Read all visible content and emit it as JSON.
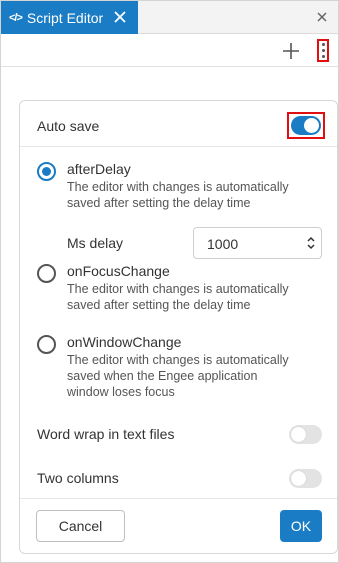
{
  "tab": {
    "title": "Script Editor",
    "icon": "code-icon",
    "active_color": "#1a7cc4"
  },
  "toolbar": {
    "add_icon": "plus-icon",
    "more_icon": "vertical-dots-icon"
  },
  "settings": {
    "auto_save": {
      "label": "Auto save",
      "enabled": true
    },
    "options": [
      {
        "title": "afterDelay",
        "description": "The editor with changes is automatically saved after setting the delay time",
        "selected": true
      },
      {
        "title": "onFocusChange",
        "description": "The editor with changes is automatically saved after setting the delay time",
        "selected": false
      },
      {
        "title": "onWindowChange",
        "description": "The editor with changes is automatically saved when the Engee application window loses focus",
        "selected": false
      }
    ],
    "ms_delay": {
      "label": "Ms delay",
      "value": "1000"
    },
    "word_wrap": {
      "label": "Word wrap in text files",
      "enabled": false
    },
    "two_columns": {
      "label": "Two columns",
      "enabled": false
    }
  },
  "buttons": {
    "cancel": "Cancel",
    "ok": "OK"
  },
  "colors": {
    "accent": "#1a7cc4",
    "highlight": "#e01010"
  }
}
